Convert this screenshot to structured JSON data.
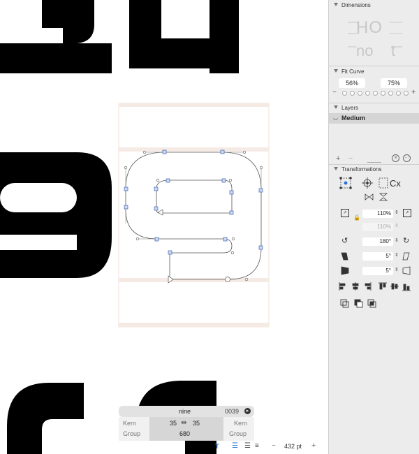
{
  "glyph_info": {
    "name": "nine",
    "unicode": "0039",
    "kern_label": "Kern",
    "group_label": "Group",
    "kern_left": "35",
    "kern_right": "35",
    "width": "680"
  },
  "zoom": {
    "minus": "−",
    "value": "432 pt",
    "plus": "+"
  },
  "sidebar": {
    "dimensions": {
      "title": "Dimensions",
      "preview_top": "HO",
      "preview_bottom_left": "no",
      "preview_bottom_right": "t"
    },
    "fit_curve": {
      "title": "Fit Curve",
      "left_value": "56%",
      "right_value": "75%",
      "minus": "−",
      "plus": "+"
    },
    "layers": {
      "title": "Layers",
      "selected_layer": "Medium",
      "add": "+",
      "remove": "−"
    },
    "transformations": {
      "title": "Transformations",
      "scale_value": "110%",
      "scale_locked_value": "110%",
      "rotate_value": "180°",
      "skew_value_1": "5°",
      "skew_value_2": "5°"
    }
  },
  "colors": {
    "accent": "#2a6fd6",
    "sidebar_bg": "#ececec",
    "guide": "#f3e6dd"
  }
}
